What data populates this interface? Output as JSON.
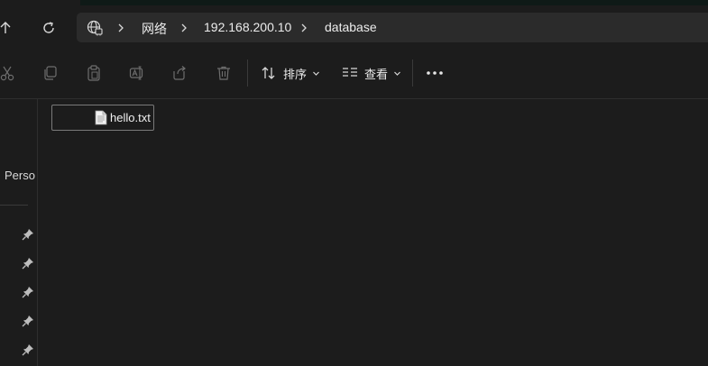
{
  "navigation": {
    "up_icon": "arrow-up-icon",
    "refresh_icon": "refresh-icon"
  },
  "address_bar": {
    "location_icon": "network-globe-icon",
    "crumbs": [
      "网络",
      "192.168.200.10",
      "database"
    ]
  },
  "toolbar": {
    "icons": [
      "cut-icon",
      "copy-icon",
      "paste-icon",
      "rename-icon",
      "share-icon",
      "delete-icon"
    ],
    "sort_label": "排序",
    "view_label": "查看",
    "more_icon": "more-icon"
  },
  "nav_pane": {
    "visible_label": "Perso",
    "pinned_count": 5
  },
  "files": [
    {
      "name": "hello.txt",
      "icon": "text-file-icon"
    }
  ],
  "colors": {
    "background": "#1c1c1c",
    "address_bar": "#2b2b2b",
    "accent_strip": "#0f1a17",
    "selection_border": "#7a7a7a"
  }
}
